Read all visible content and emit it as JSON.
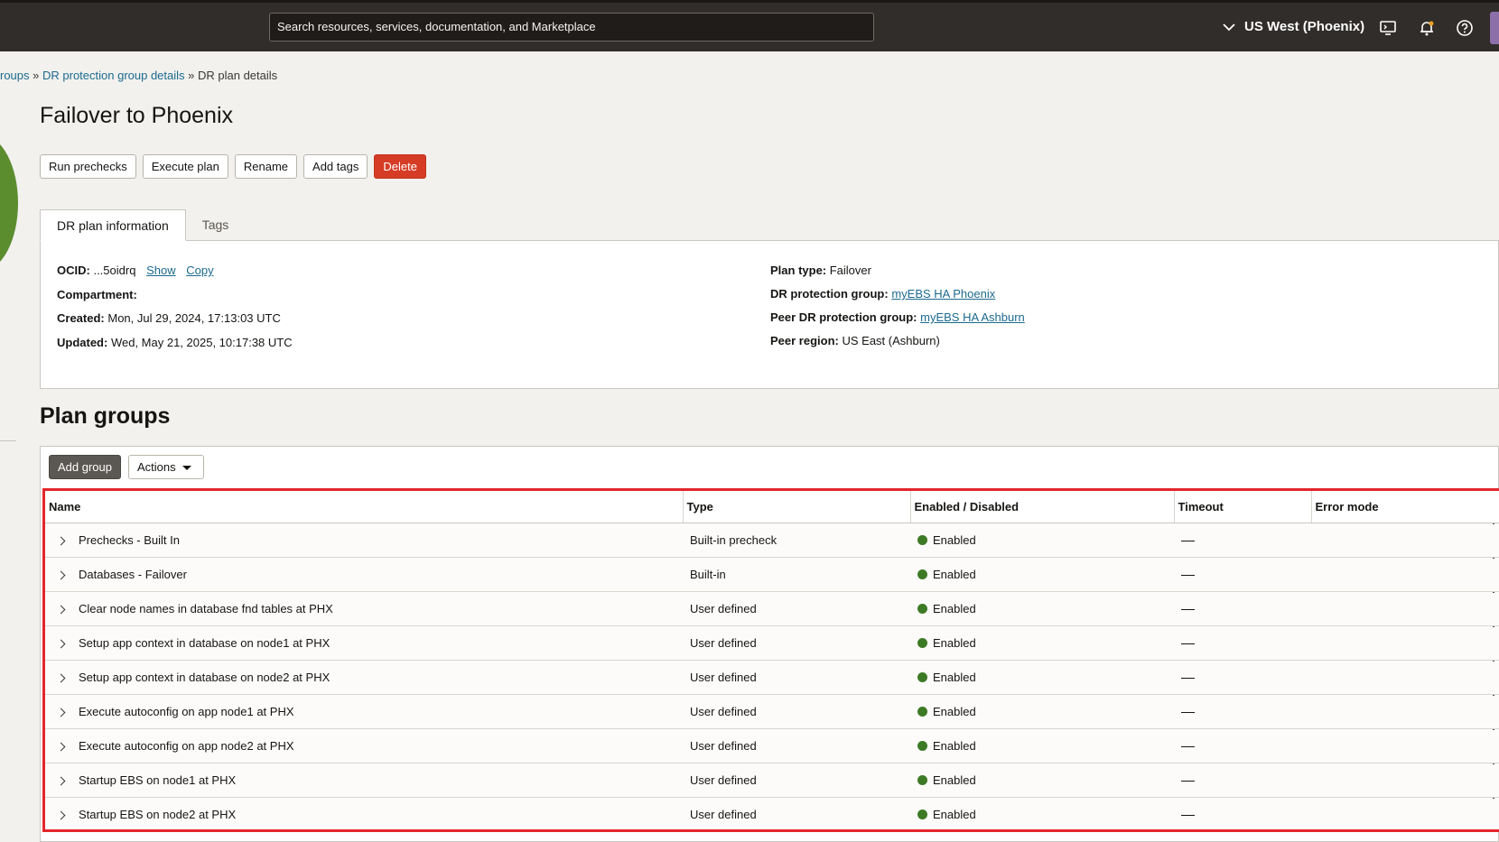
{
  "topbar": {
    "search_placeholder": "Search resources, services, documentation, and Marketplace",
    "region": "US West (Phoenix)"
  },
  "breadcrumb": {
    "item1": "roups",
    "sep1": " » ",
    "item2": "DR protection group details",
    "sep2": " » ",
    "current": "DR plan details"
  },
  "page_title": "Failover to Phoenix",
  "actions": {
    "run_prechecks": "Run prechecks",
    "execute_plan": "Execute plan",
    "rename": "Rename",
    "add_tags": "Add tags",
    "delete": "Delete"
  },
  "tabs": {
    "info": "DR plan information",
    "tags": "Tags"
  },
  "info": {
    "ocid_label": "OCID:",
    "ocid_value": " ...5oidrq",
    "show": "Show",
    "copy": "Copy",
    "compartment_label": "Compartment:",
    "created_label": "Created:",
    "created_value": " Mon, Jul 29, 2024, 17:13:03 UTC",
    "updated_label": "Updated:",
    "updated_value": " Wed, May 21, 2025, 10:17:38 UTC",
    "plan_type_label": "Plan type:",
    "plan_type_value": " Failover",
    "dr_group_label": "DR protection group:",
    "dr_group_value": "myEBS HA Phoenix",
    "peer_group_label": "Peer DR protection group:",
    "peer_group_value": "myEBS HA Ashburn",
    "peer_region_label": "Peer region:",
    "peer_region_value": " US East (Ashburn)"
  },
  "plan_groups": {
    "title": "Plan groups",
    "add_group": "Add group",
    "actions": "Actions",
    "columns": {
      "name": "Name",
      "type": "Type",
      "enabled": "Enabled / Disabled",
      "timeout": "Timeout",
      "error_mode": "Error mode"
    },
    "rows": [
      {
        "name": "Prechecks - Built In",
        "type": "Built-in precheck",
        "status": "Enabled"
      },
      {
        "name": "Databases - Failover",
        "type": "Built-in",
        "status": "Enabled"
      },
      {
        "name": "Clear node names in database fnd tables at PHX",
        "type": "User defined",
        "status": "Enabled"
      },
      {
        "name": "Setup app context in database on node1 at PHX",
        "type": "User defined",
        "status": "Enabled"
      },
      {
        "name": "Setup app context in database on node2 at PHX",
        "type": "User defined",
        "status": "Enabled"
      },
      {
        "name": "Execute autoconfig on app node1 at PHX",
        "type": "User defined",
        "status": "Enabled"
      },
      {
        "name": "Execute autoconfig on app node2 at PHX",
        "type": "User defined",
        "status": "Enabled"
      },
      {
        "name": "Startup EBS on node1 at PHX",
        "type": "User defined",
        "status": "Enabled"
      },
      {
        "name": "Startup EBS on node2 at PHX",
        "type": "User defined",
        "status": "Enabled"
      }
    ]
  },
  "colors": {
    "accent_link": "#1c6a8e",
    "danger": "#d63b25",
    "enabled_dot": "#3d7a25",
    "highlight_border": "#e3262b"
  }
}
